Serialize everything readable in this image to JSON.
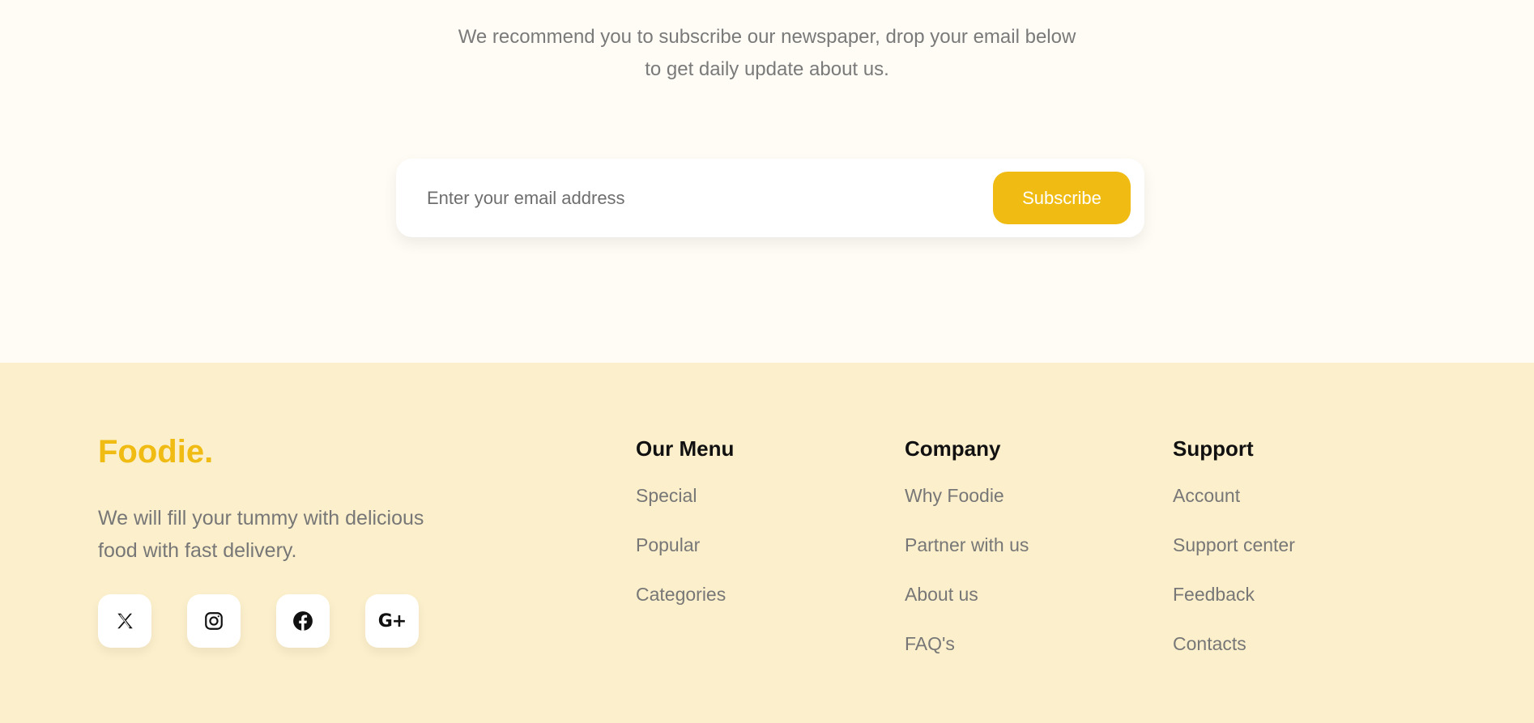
{
  "newsletter": {
    "text_lines": [
      "We recommend you to subscribe our newspaper, drop your email below",
      "to get daily update about us."
    ],
    "email_placeholder": "Enter your email address",
    "subscribe_label": "Subscribe"
  },
  "footer": {
    "brand": "Foodie.",
    "tagline_lines": [
      "We will fill your tummy with delicious",
      "food with fast delivery."
    ],
    "socials": [
      {
        "icon": "x-twitter-icon"
      },
      {
        "icon": "instagram-icon"
      },
      {
        "icon": "facebook-icon"
      },
      {
        "icon": "google-plus-icon",
        "glyph": "G+"
      }
    ],
    "columns": [
      {
        "title": "Our Menu",
        "links": [
          "Special",
          "Popular",
          "Categories"
        ]
      },
      {
        "title": "Company",
        "links": [
          "Why Foodie",
          "Partner with us",
          "About us",
          "FAQ's"
        ]
      },
      {
        "title": "Support",
        "links": [
          "Account",
          "Support center",
          "Feedback",
          "Contacts"
        ]
      }
    ]
  },
  "colors": {
    "accent": "#f0bb12",
    "page_bg": "#fffcf5",
    "footer_bg": "#fcefcb"
  }
}
